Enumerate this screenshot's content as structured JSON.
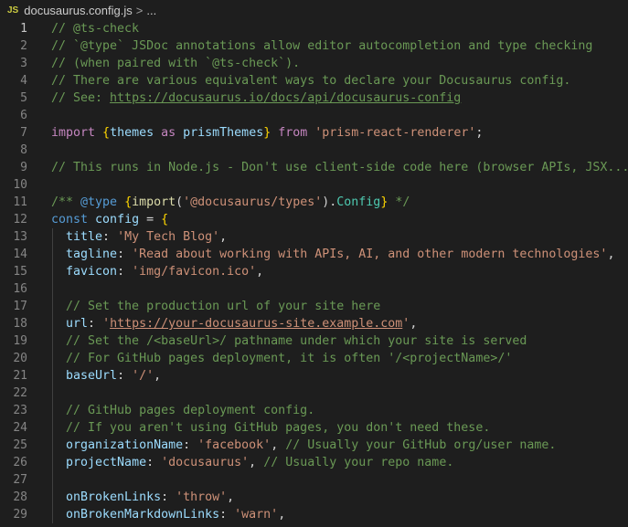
{
  "breadcrumb": {
    "icon": "JS",
    "file": "docusaurus.config.js",
    "separator": ">",
    "more": "..."
  },
  "lines": [
    {
      "n": "1",
      "t": [
        [
          "c-com",
          "// @ts-check"
        ]
      ]
    },
    {
      "n": "2",
      "t": [
        [
          "c-com",
          "// `@type` JSDoc annotations allow editor autocompletion and type checking"
        ]
      ]
    },
    {
      "n": "3",
      "t": [
        [
          "c-com",
          "// (when paired with `@ts-check`)."
        ]
      ]
    },
    {
      "n": "4",
      "t": [
        [
          "c-com",
          "// There are various equivalent ways to declare your Docusaurus config."
        ]
      ]
    },
    {
      "n": "5",
      "t": [
        [
          "c-com",
          "// See: "
        ],
        [
          "c-com u",
          "https://docusaurus.io/docs/api/docusaurus-config"
        ]
      ]
    },
    {
      "n": "6",
      "t": []
    },
    {
      "n": "7",
      "t": [
        [
          "c-imp",
          "import "
        ],
        [
          "c-brace",
          "{"
        ],
        [
          "c-var",
          "themes"
        ],
        [
          "c-imp",
          " as "
        ],
        [
          "c-var",
          "prismThemes"
        ],
        [
          "c-brace",
          "}"
        ],
        [
          "c-imp",
          " from "
        ],
        [
          "c-str",
          "'prism-react-renderer'"
        ],
        [
          "c-punc",
          ";"
        ]
      ]
    },
    {
      "n": "8",
      "t": []
    },
    {
      "n": "9",
      "t": [
        [
          "c-com",
          "// This runs in Node.js - Don't use client-side code here (browser APIs, JSX...)"
        ]
      ]
    },
    {
      "n": "10",
      "t": []
    },
    {
      "n": "11",
      "t": [
        [
          "c-com",
          "/** "
        ],
        [
          "c-kw",
          "@type"
        ],
        [
          "c-com",
          " "
        ],
        [
          "c-brace",
          "{"
        ],
        [
          "c-fn",
          "import"
        ],
        [
          "c-punc",
          "("
        ],
        [
          "c-str",
          "'@docusaurus/types'"
        ],
        [
          "c-punc",
          ")."
        ],
        [
          "c-type",
          "Config"
        ],
        [
          "c-brace",
          "}"
        ],
        [
          "c-com",
          " */"
        ]
      ]
    },
    {
      "n": "12",
      "t": [
        [
          "c-kw",
          "const "
        ],
        [
          "c-var",
          "config"
        ],
        [
          "c-punc",
          " = "
        ],
        [
          "c-brace",
          "{"
        ]
      ]
    },
    {
      "n": "13",
      "g": true,
      "t": [
        [
          "c-punc",
          "  "
        ],
        [
          "c-var",
          "title"
        ],
        [
          "c-punc",
          ": "
        ],
        [
          "c-str",
          "'My Tech Blog'"
        ],
        [
          "c-punc",
          ","
        ]
      ]
    },
    {
      "n": "14",
      "g": true,
      "t": [
        [
          "c-punc",
          "  "
        ],
        [
          "c-var",
          "tagline"
        ],
        [
          "c-punc",
          ": "
        ],
        [
          "c-str",
          "'Read about working with APIs, AI, and other modern technologies'"
        ],
        [
          "c-punc",
          ","
        ]
      ]
    },
    {
      "n": "15",
      "g": true,
      "t": [
        [
          "c-punc",
          "  "
        ],
        [
          "c-var",
          "favicon"
        ],
        [
          "c-punc",
          ": "
        ],
        [
          "c-str",
          "'img/favicon.ico'"
        ],
        [
          "c-punc",
          ","
        ]
      ]
    },
    {
      "n": "16",
      "g": true,
      "t": []
    },
    {
      "n": "17",
      "g": true,
      "t": [
        [
          "c-com",
          "  // Set the production url of your site here"
        ]
      ]
    },
    {
      "n": "18",
      "g": true,
      "t": [
        [
          "c-punc",
          "  "
        ],
        [
          "c-var",
          "url"
        ],
        [
          "c-punc",
          ": "
        ],
        [
          "c-str",
          "'"
        ],
        [
          "c-str u",
          "https://your-docusaurus-site.example.com"
        ],
        [
          "c-str",
          "'"
        ],
        [
          "c-punc",
          ","
        ]
      ]
    },
    {
      "n": "19",
      "g": true,
      "t": [
        [
          "c-com",
          "  // Set the /<baseUrl>/ pathname under which your site is served"
        ]
      ]
    },
    {
      "n": "20",
      "g": true,
      "t": [
        [
          "c-com",
          "  // For GitHub pages deployment, it is often '/<projectName>/'"
        ]
      ]
    },
    {
      "n": "21",
      "g": true,
      "t": [
        [
          "c-punc",
          "  "
        ],
        [
          "c-var",
          "baseUrl"
        ],
        [
          "c-punc",
          ": "
        ],
        [
          "c-str",
          "'/'"
        ],
        [
          "c-punc",
          ","
        ]
      ]
    },
    {
      "n": "22",
      "g": true,
      "t": []
    },
    {
      "n": "23",
      "g": true,
      "t": [
        [
          "c-com",
          "  // GitHub pages deployment config."
        ]
      ]
    },
    {
      "n": "24",
      "g": true,
      "t": [
        [
          "c-com",
          "  // If you aren't using GitHub pages, you don't need these."
        ]
      ]
    },
    {
      "n": "25",
      "g": true,
      "t": [
        [
          "c-punc",
          "  "
        ],
        [
          "c-var",
          "organizationName"
        ],
        [
          "c-punc",
          ": "
        ],
        [
          "c-str",
          "'facebook'"
        ],
        [
          "c-punc",
          ", "
        ],
        [
          "c-com",
          "// Usually your GitHub org/user name."
        ]
      ]
    },
    {
      "n": "26",
      "g": true,
      "t": [
        [
          "c-punc",
          "  "
        ],
        [
          "c-var",
          "projectName"
        ],
        [
          "c-punc",
          ": "
        ],
        [
          "c-str",
          "'docusaurus'"
        ],
        [
          "c-punc",
          ", "
        ],
        [
          "c-com",
          "// Usually your repo name."
        ]
      ]
    },
    {
      "n": "27",
      "g": true,
      "t": []
    },
    {
      "n": "28",
      "g": true,
      "t": [
        [
          "c-punc",
          "  "
        ],
        [
          "c-var",
          "onBrokenLinks"
        ],
        [
          "c-punc",
          ": "
        ],
        [
          "c-str",
          "'throw'"
        ],
        [
          "c-punc",
          ","
        ]
      ]
    },
    {
      "n": "29",
      "g": true,
      "t": [
        [
          "c-punc",
          "  "
        ],
        [
          "c-var",
          "onBrokenMarkdownLinks"
        ],
        [
          "c-punc",
          ": "
        ],
        [
          "c-str",
          "'warn'"
        ],
        [
          "c-punc",
          ","
        ]
      ]
    }
  ]
}
